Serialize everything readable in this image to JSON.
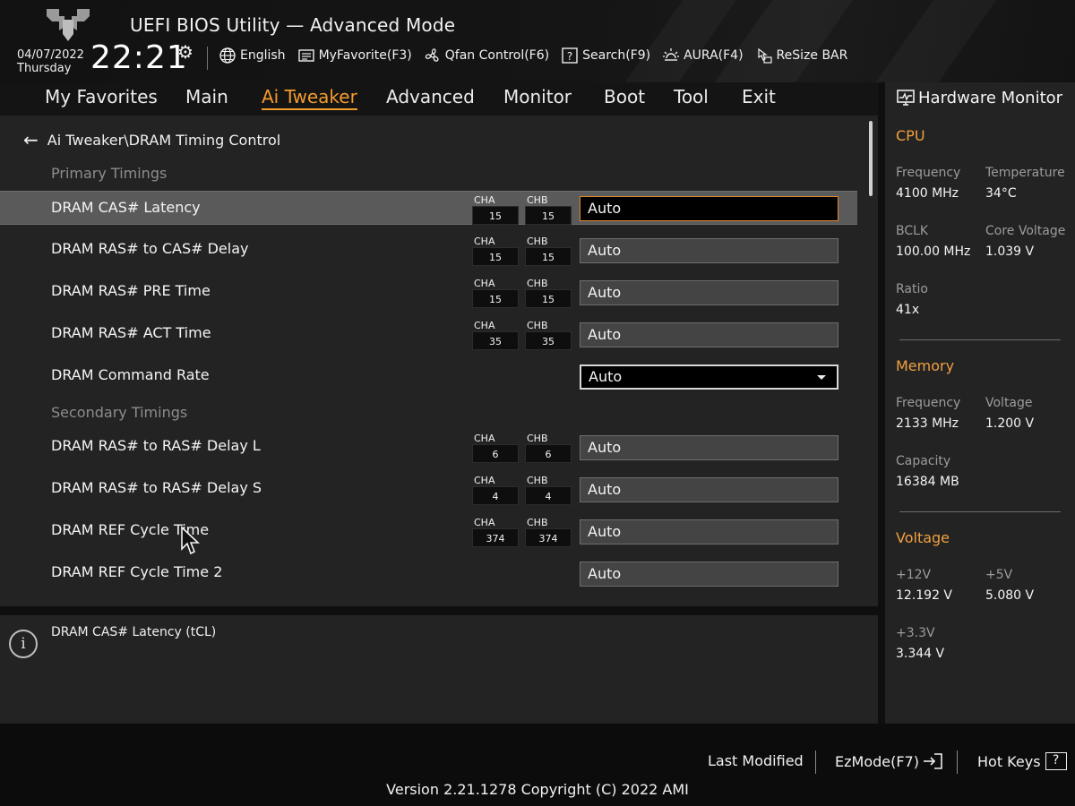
{
  "header": {
    "title": "UEFI BIOS Utility — Advanced Mode",
    "date": "04/07/2022",
    "day": "Thursday",
    "time": "22:21",
    "toolbar": [
      {
        "label": "English",
        "icon": "globe-icon"
      },
      {
        "label": "MyFavorite(F3)",
        "icon": "favorite-icon"
      },
      {
        "label": "Qfan Control(F6)",
        "icon": "fan-icon"
      },
      {
        "label": "Search(F9)",
        "icon": "search-help-icon"
      },
      {
        "label": "AURA(F4)",
        "icon": "aura-icon"
      },
      {
        "label": "ReSize BAR",
        "icon": "resize-bar-icon"
      }
    ]
  },
  "nav": {
    "tabs": [
      "My Favorites",
      "Main",
      "Ai Tweaker",
      "Advanced",
      "Monitor",
      "Boot",
      "Tool",
      "Exit"
    ],
    "active": "Ai Tweaker"
  },
  "main": {
    "breadcrumb": "Ai Tweaker\\DRAM Timing Control",
    "sections": {
      "primary": "Primary Timings",
      "secondary": "Secondary Timings"
    },
    "channel_labels": {
      "a": "CHA",
      "b": "CHB"
    },
    "rows": [
      {
        "label": "DRAM CAS# Latency",
        "cha": "15",
        "chb": "15",
        "value": "Auto"
      },
      {
        "label": "DRAM RAS# to CAS# Delay",
        "cha": "15",
        "chb": "15",
        "value": "Auto"
      },
      {
        "label": "DRAM RAS# PRE Time",
        "cha": "15",
        "chb": "15",
        "value": "Auto"
      },
      {
        "label": "DRAM RAS# ACT Time",
        "cha": "35",
        "chb": "35",
        "value": "Auto"
      },
      {
        "label": "DRAM Command Rate",
        "value": "Auto"
      },
      {
        "label": "DRAM RAS# to RAS# Delay L",
        "cha": "6",
        "chb": "6",
        "value": "Auto"
      },
      {
        "label": "DRAM RAS# to RAS# Delay S",
        "cha": "4",
        "chb": "4",
        "value": "Auto"
      },
      {
        "label": "DRAM REF Cycle Time",
        "cha": "374",
        "chb": "374",
        "value": "Auto"
      },
      {
        "label": "DRAM REF Cycle Time 2",
        "value": "Auto"
      }
    ],
    "help_text": "DRAM CAS# Latency (tCL)"
  },
  "hardware_monitor": {
    "title": "Hardware Monitor",
    "cpu": {
      "heading": "CPU",
      "frequency_label": "Frequency",
      "frequency": "4100 MHz",
      "temperature_label": "Temperature",
      "temperature": "34°C",
      "bclk_label": "BCLK",
      "bclk": "100.00 MHz",
      "core_voltage_label": "Core Voltage",
      "core_voltage": "1.039 V",
      "ratio_label": "Ratio",
      "ratio": "41x"
    },
    "memory": {
      "heading": "Memory",
      "frequency_label": "Frequency",
      "frequency": "2133 MHz",
      "voltage_label": "Voltage",
      "voltage": "1.200 V",
      "capacity_label": "Capacity",
      "capacity": "16384 MB"
    },
    "voltage": {
      "heading": "Voltage",
      "v12_label": "+12V",
      "v12": "12.192 V",
      "v5_label": "+5V",
      "v5": "5.080 V",
      "v33_label": "+3.3V",
      "v33": "3.344 V"
    }
  },
  "footer": {
    "last_modified": "Last Modified",
    "ezmode": "EzMode(F7)",
    "hotkeys": "Hot Keys",
    "hotkeys_icon": "?",
    "version": "Version 2.21.1278 Copyright (C) 2022 AMI"
  },
  "colors": {
    "accent": "#f29a2e",
    "selected_row": "#5a5a5a",
    "panel": "#232323",
    "background": "#0f0f0f"
  }
}
